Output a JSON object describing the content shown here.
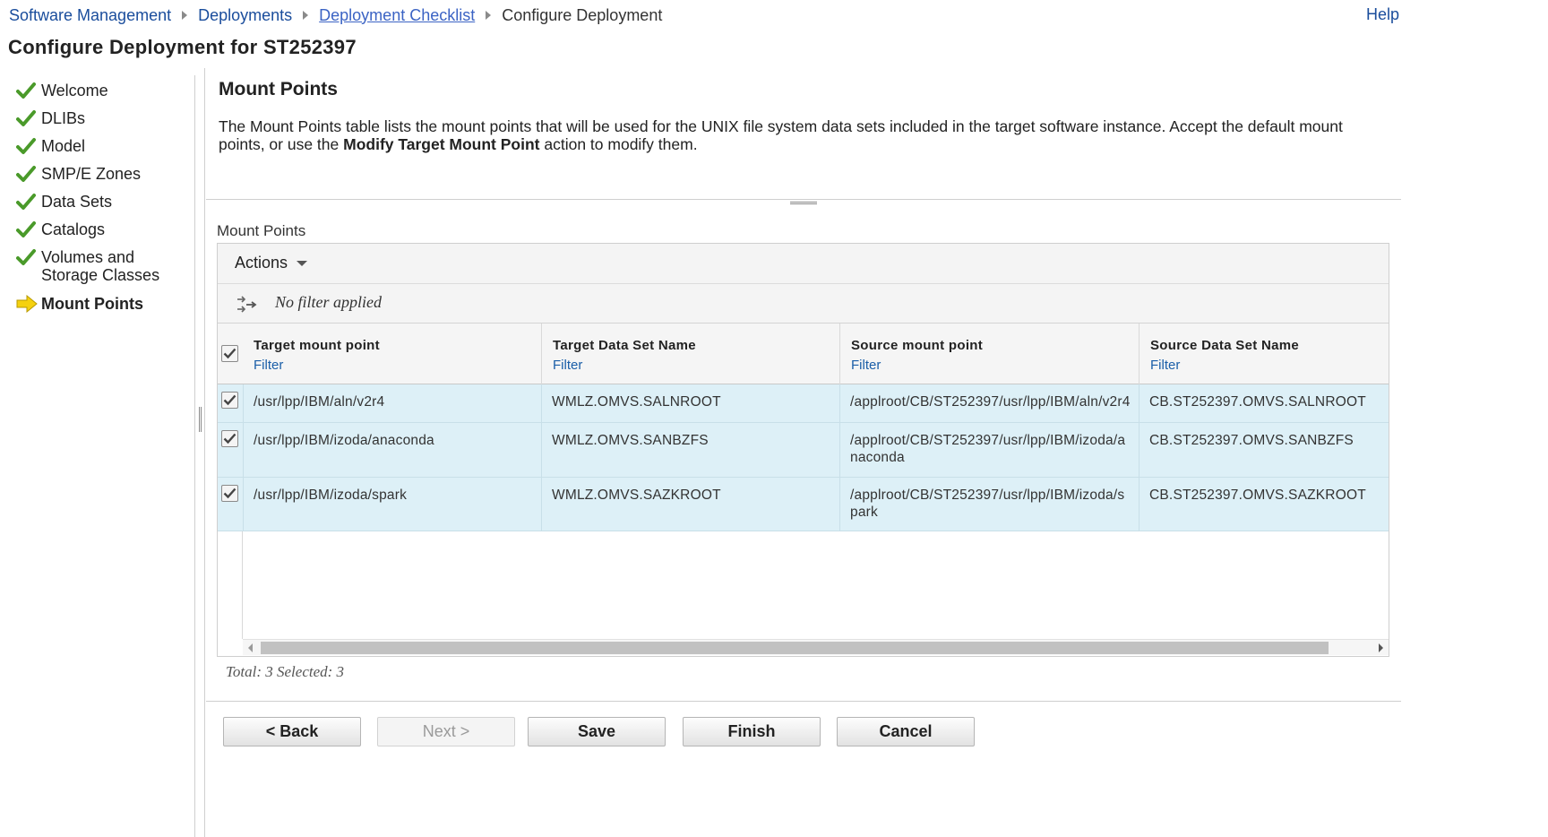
{
  "breadcrumb": {
    "items": [
      {
        "label": "Software Management"
      },
      {
        "label": "Deployments"
      },
      {
        "label": "Deployment Checklist"
      },
      {
        "label": "Configure Deployment"
      }
    ]
  },
  "help_label": "Help",
  "page_title": "Configure Deployment for ST252397",
  "nav": {
    "items": [
      {
        "label": "Welcome",
        "status": "complete"
      },
      {
        "label": "DLIBs",
        "status": "complete"
      },
      {
        "label": "Model",
        "status": "complete"
      },
      {
        "label": "SMP/E Zones",
        "status": "complete"
      },
      {
        "label": "Data Sets",
        "status": "complete"
      },
      {
        "label": "Catalogs",
        "status": "complete"
      },
      {
        "label": "Volumes and Storage Classes",
        "status": "complete"
      },
      {
        "label": "Mount Points",
        "status": "current"
      }
    ]
  },
  "section": {
    "title": "Mount Points",
    "description_part1": "The Mount Points table lists the mount points that will be used for the UNIX file system data sets included in the target software instance.  Accept the default mount points, or use the ",
    "description_bold": "Modify Target Mount Point",
    "description_part2": " action to modify them."
  },
  "table": {
    "caption": "Mount Points",
    "actions_label": "Actions",
    "filter_status": "No filter applied",
    "columns": [
      {
        "label": "Target mount point",
        "filter": "Filter"
      },
      {
        "label": "Target Data Set Name",
        "filter": "Filter"
      },
      {
        "label": "Source mount point",
        "filter": "Filter"
      },
      {
        "label": "Source Data Set Name",
        "filter": "Filter"
      }
    ],
    "rows": [
      {
        "checked": true,
        "target_mount": "/usr/lpp/IBM/aln/v2r4",
        "target_dsn": "WMLZ.OMVS.SALNROOT",
        "source_mount": "/applroot/CB/ST252397/usr/lpp/IBM/aln/v2r4",
        "source_dsn": "CB.ST252397.OMVS.SALNROOT"
      },
      {
        "checked": true,
        "target_mount": "/usr/lpp/IBM/izoda/anaconda",
        "target_dsn": "WMLZ.OMVS.SANBZFS",
        "source_mount": "/applroot/CB/ST252397/usr/lpp/IBM/izoda/anaconda",
        "source_dsn": "CB.ST252397.OMVS.SANBZFS"
      },
      {
        "checked": true,
        "target_mount": "/usr/lpp/IBM/izoda/spark",
        "target_dsn": "WMLZ.OMVS.SAZKROOT",
        "source_mount": "/applroot/CB/ST252397/usr/lpp/IBM/izoda/spark",
        "source_dsn": "CB.ST252397.OMVS.SAZKROOT"
      }
    ],
    "footer": "Total: 3 Selected: 3"
  },
  "buttons": {
    "back": "< Back",
    "next": "Next >",
    "save": "Save",
    "finish": "Finish",
    "cancel": "Cancel"
  },
  "colors": {
    "link": "#1a4d9c",
    "row_selected_bg": "#ddf0f7",
    "check_green": "#4a9a2a",
    "current_arrow": "#f5d10f"
  },
  "icons": [
    "check-icon",
    "arrow-right-icon",
    "filter-icon",
    "chevron-down-icon",
    "checkbox-checked-icon"
  ]
}
